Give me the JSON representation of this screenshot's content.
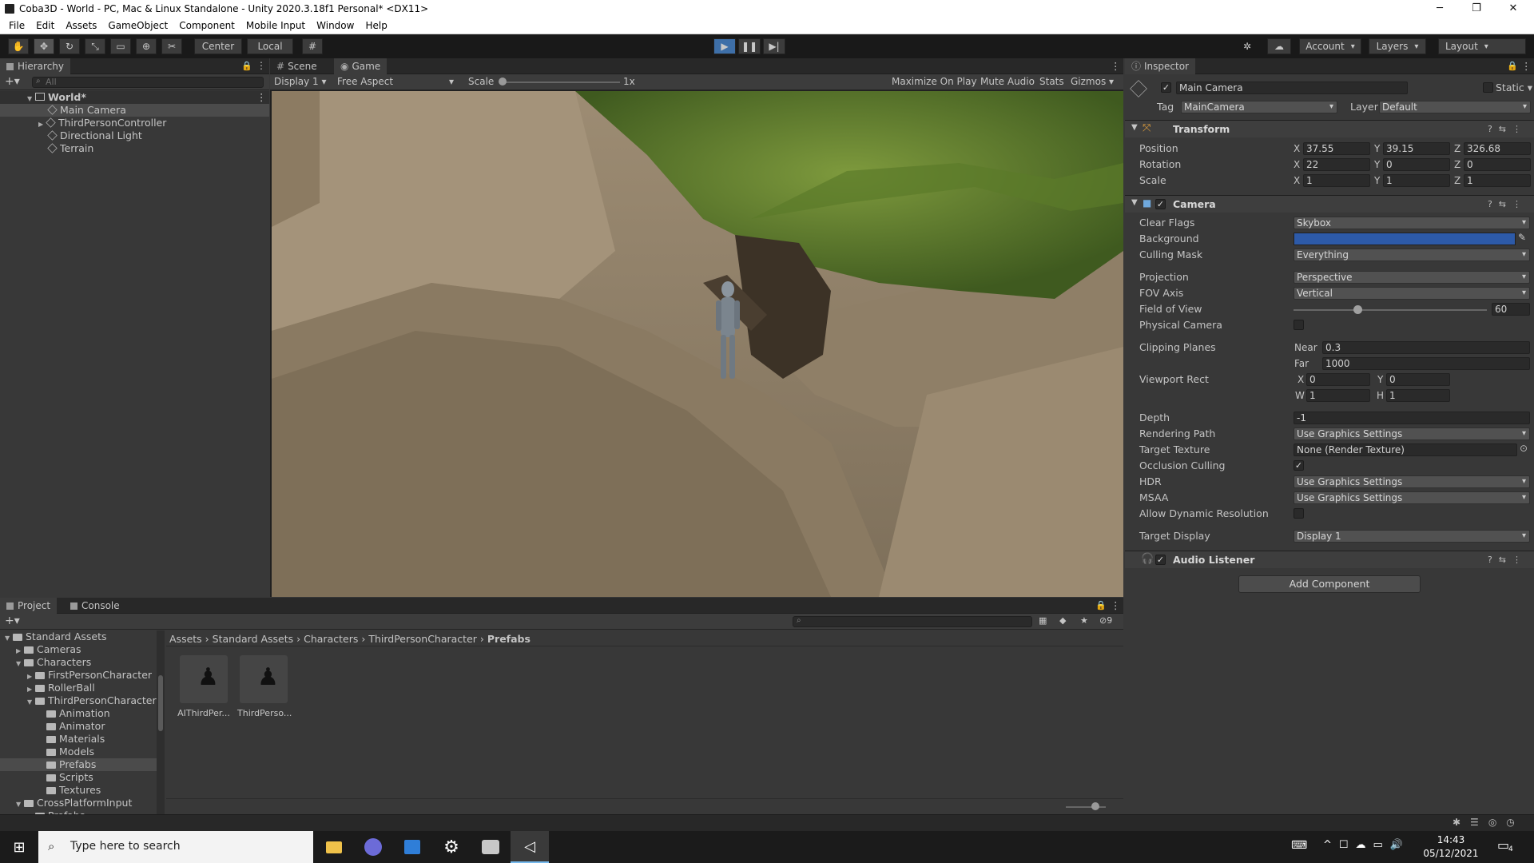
{
  "window": {
    "title": "Coba3D - World - PC, Mac & Linux Standalone - Unity 2020.3.18f1 Personal* <DX11>"
  },
  "menu": [
    "File",
    "Edit",
    "Assets",
    "GameObject",
    "Component",
    "Mobile Input",
    "Window",
    "Help"
  ],
  "toolbar": {
    "pivot": "Center",
    "space": "Local",
    "account": "Account",
    "layers": "Layers",
    "layout": "Layout"
  },
  "hierarchy": {
    "tab": "Hierarchy",
    "search_placeholder": "All",
    "scene": "World*",
    "items": [
      "Main Camera",
      "ThirdPersonController",
      "Directional Light",
      "Terrain"
    ]
  },
  "game": {
    "tab_scene": "Scene",
    "tab_game": "Game",
    "display": "Display 1",
    "aspect": "Free Aspect",
    "scale_label": "Scale",
    "scale_value": "1x",
    "maximize": "Maximize On Play",
    "mute": "Mute Audio",
    "stats": "Stats",
    "gizmos": "Gizmos"
  },
  "inspector": {
    "tab": "Inspector",
    "object_name": "Main Camera",
    "static": "Static",
    "tag_label": "Tag",
    "tag": "MainCamera",
    "layer_label": "Layer",
    "layer": "Default",
    "transform": {
      "title": "Transform",
      "position_label": "Position",
      "rotation_label": "Rotation",
      "scale_label": "Scale",
      "position": {
        "x": "37.55",
        "y": "39.15",
        "z": "326.68"
      },
      "rotation": {
        "x": "22",
        "y": "0",
        "z": "0"
      },
      "scale": {
        "x": "1",
        "y": "1",
        "z": "1"
      }
    },
    "camera": {
      "title": "Camera",
      "clear_flags_label": "Clear Flags",
      "clear_flags": "Skybox",
      "background_label": "Background",
      "background_color": "#2d5aa8",
      "culling_mask_label": "Culling Mask",
      "culling_mask": "Everything",
      "projection_label": "Projection",
      "projection": "Perspective",
      "fov_axis_label": "FOV Axis",
      "fov_axis": "Vertical",
      "fov_label": "Field of View",
      "fov": "60",
      "fov_fraction": 0.33,
      "physical_label": "Physical Camera",
      "clipping_label": "Clipping Planes",
      "near_label": "Near",
      "near": "0.3",
      "far_label": "Far",
      "far": "1000",
      "viewport_label": "Viewport Rect",
      "vx": "0",
      "vy": "0",
      "vw": "1",
      "vh": "1",
      "depth_label": "Depth",
      "depth": "-1",
      "rendering_path_label": "Rendering Path",
      "rendering_path": "Use Graphics Settings",
      "target_texture_label": "Target Texture",
      "target_texture": "None (Render Texture)",
      "occlusion_label": "Occlusion Culling",
      "hdr_label": "HDR",
      "hdr": "Use Graphics Settings",
      "msaa_label": "MSAA",
      "msaa": "Use Graphics Settings",
      "dynamic_res_label": "Allow Dynamic Resolution",
      "target_display_label": "Target Display",
      "target_display": "Display 1"
    },
    "audio_listener": "Audio Listener",
    "add_component": "Add Component"
  },
  "project": {
    "tab_project": "Project",
    "tab_console": "Console",
    "hidden_count": "9",
    "tree": [
      {
        "label": "Standard Assets",
        "level": 1,
        "open": true
      },
      {
        "label": "Cameras",
        "level": 2,
        "open": false
      },
      {
        "label": "Characters",
        "level": 2,
        "open": true
      },
      {
        "label": "FirstPersonCharacter",
        "level": 3,
        "open": false
      },
      {
        "label": "RollerBall",
        "level": 3,
        "open": false
      },
      {
        "label": "ThirdPersonCharacter",
        "level": 3,
        "open": true
      },
      {
        "label": "Animation",
        "level": 4
      },
      {
        "label": "Animator",
        "level": 4
      },
      {
        "label": "Materials",
        "level": 4
      },
      {
        "label": "Models",
        "level": 4
      },
      {
        "label": "Prefabs",
        "level": 4,
        "selected": true
      },
      {
        "label": "Scripts",
        "level": 4
      },
      {
        "label": "Textures",
        "level": 4
      },
      {
        "label": "CrossPlatformInput",
        "level": 2,
        "open": true
      },
      {
        "label": "Prefabs",
        "level": 3
      }
    ],
    "breadcrumb": [
      "Assets",
      "Standard Assets",
      "Characters",
      "ThirdPersonCharacter",
      "Prefabs"
    ],
    "assets": [
      "AIThirdPer...",
      "ThirdPerso..."
    ]
  },
  "taskbar": {
    "search_placeholder": "Type here to search",
    "time": "14:43",
    "date": "05/12/2021",
    "notifications": "4"
  }
}
